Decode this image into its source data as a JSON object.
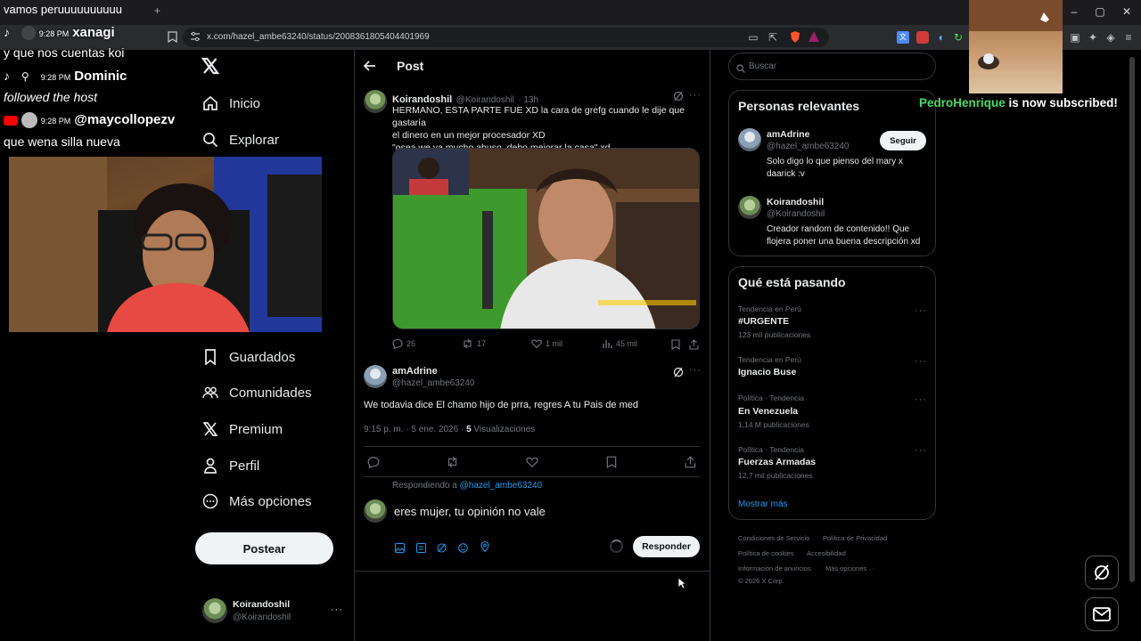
{
  "browser": {
    "tab_title": "vamos peruuuuuuuuuu",
    "new_tab": "+",
    "url": "x.com/hazel_ambe63240/status/2008361805404401969"
  },
  "stream": {
    "chat": [
      {
        "time": "9:28 PM",
        "user": "xanagi",
        "message": "y que nos cuentas koi"
      },
      {
        "time": "9:28 PM",
        "user": "Dominic",
        "message": "followed the host"
      },
      {
        "time": "9:28 PM",
        "user": "@maycollopezv",
        "message": "que wena silla nueva"
      }
    ],
    "alert_user": "PedroHenrique",
    "alert_text": "is now subscribed!"
  },
  "nav": {
    "items": [
      "Inicio",
      "Explorar",
      "Guardados",
      "Comunidades",
      "Premium",
      "Perfil",
      "Más opciones"
    ],
    "post_button": "Postear",
    "account_name": "Koirandoshil",
    "account_handle": "@Koirandoshil"
  },
  "main": {
    "header": "Post",
    "quoted": {
      "name": "Koirandoshil",
      "handle": "@Koirandoshil",
      "time": "· 13h",
      "text_lines": [
        "HERMANO, ESTA PARTE FUE XD la cara de grefg cuando le dije que gastaría",
        "el dinero en un mejor procesador XD",
        "\"osea we ya mucho abuso, debo mejorar la casa\" xd"
      ],
      "replies": "26",
      "reposts": "17",
      "likes": "1 mil",
      "views": "45 mil"
    },
    "reply": {
      "name": "amAdrine",
      "handle": "@hazel_ambe63240",
      "text": "We todavia dice El chamo hijo de prra, regres A tu Pais de med",
      "date": "9:15 p. m. · 5 ene. 2026 ·",
      "views_count": "5",
      "views_label": "Visualizaciones"
    },
    "compose": {
      "replying_to_label": "Respondiendo a",
      "replying_to_handle": "@hazel_ambe63240",
      "text": "eres mujer, tu opinión no vale",
      "button": "Responder"
    }
  },
  "right": {
    "search_placeholder": "Buscar",
    "relevant_title": "Personas relevantes",
    "people": [
      {
        "name": "amAdrine",
        "handle": "@hazel_ambe63240",
        "bio": [
          "Solo digo lo que pienso del mary x",
          "daarick :v"
        ],
        "button": "Seguir"
      },
      {
        "name": "Koirandoshil",
        "handle": "@Koirandoshil",
        "bio": [
          "Creador random de contenido!! Que",
          "flojera poner una buena descripción xd"
        ]
      }
    ],
    "trends_title": "Qué está pasando",
    "trends": [
      {
        "context": "Tendencia en Perú",
        "name": "#URGENTE",
        "count": "123 mil publicaciones"
      },
      {
        "context": "Tendencia en Perú",
        "name": "Ignacio Buse",
        "count": ""
      },
      {
        "context": "Política · Tendencia",
        "name": "En Venezuela",
        "count": "1,14 M publicaciones"
      },
      {
        "context": "Política · Tendencia",
        "name": "Fuerzas Armadas",
        "count": "12,7 mil publicaciones"
      }
    ],
    "show_more": "Mostrar más",
    "footer": [
      "Condiciones de Servicio",
      "Política de Privacidad",
      "Política de cookies",
      "Accesibilidad",
      "Información de anuncios",
      "Más opciones ···",
      "© 2026 X Corp."
    ]
  },
  "colors": {
    "accent": "#1d9bf0",
    "background": "#000000",
    "border": "#2f3336",
    "alert_green": "#4cd964"
  }
}
